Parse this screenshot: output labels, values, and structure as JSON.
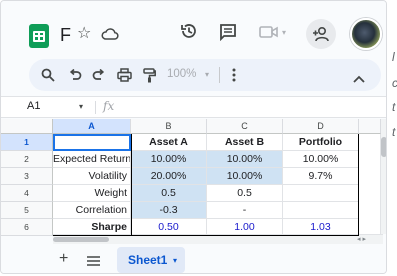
{
  "app": {
    "doc_title": "F"
  },
  "toolbar": {
    "zoom": "100%"
  },
  "formula_bar": {
    "name_box": "A1",
    "fx": "fx",
    "formula": ""
  },
  "grid": {
    "columns": [
      "A",
      "B",
      "C",
      "D"
    ],
    "rows": [
      "1",
      "2",
      "3",
      "4",
      "5",
      "6"
    ],
    "cells": {
      "a1": "",
      "b1": "Asset A",
      "c1": "Asset B",
      "d1": "Portfolio",
      "a2": "Expected Return",
      "b2": "10.00%",
      "c2": "10.00%",
      "d2": "10.00%",
      "a3": "Volatility",
      "b3": "20.00%",
      "c3": "10.00%",
      "d3": "9.7%",
      "a4": "Weight",
      "b4": "0.5",
      "c4": "0.5",
      "d4": "",
      "a5": "Correlation",
      "b5": "-0.3",
      "c5": "-",
      "d5": "",
      "a6": "Sharpe",
      "b6": "0.50",
      "c6": "1.00",
      "d6": "1.03"
    }
  },
  "sheets": {
    "tabs": [
      "Sheet1"
    ]
  },
  "side_text": [
    "l",
    "c",
    "t",
    "t"
  ],
  "colors": {
    "accent": "#0b57d0",
    "sheets_green": "#0f9d58",
    "shade": "#cfe2f3",
    "sharpe_blue": "#1a1acc"
  }
}
